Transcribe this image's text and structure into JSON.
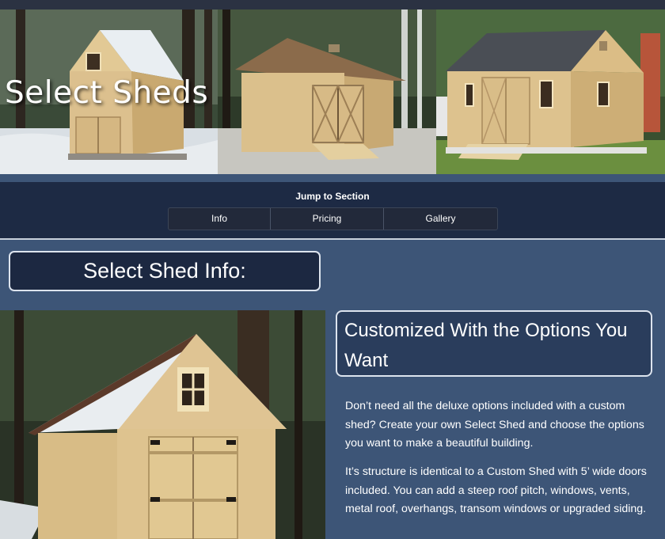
{
  "hero": {
    "title": "Select Sheds"
  },
  "jump": {
    "label": "Jump to Section",
    "items": [
      {
        "label": "Info"
      },
      {
        "label": "Pricing"
      },
      {
        "label": "Gallery"
      }
    ]
  },
  "info": {
    "heading": "Select Shed Info:",
    "feature_heading": "Customized With the Options You Want",
    "paragraphs": [
      "Don’t need all the deluxe options included with a custom shed? Create your own Select Shed and choose the options you want to make a beautiful building.",
      "It’s structure is identical to a Custom Shed with 5’ wide doors included. You can add a steep roof pitch, windows, vents, metal roof, overhangs, transom windows or upgraded siding."
    ]
  },
  "colors": {
    "page_bg": "#3d5577",
    "nav_bg": "#1d2a44",
    "heading_bg": "#1c2841",
    "wood": "#dcc08e"
  },
  "images": [
    "shed-photo-1",
    "shed-photo-2",
    "shed-photo-3",
    "shed-photo-main"
  ]
}
